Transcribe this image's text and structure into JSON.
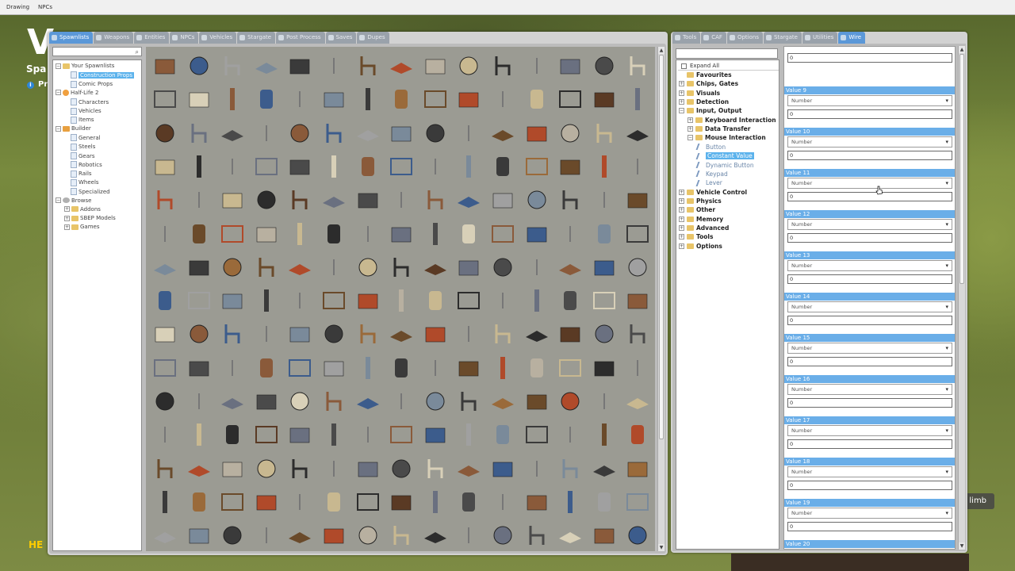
{
  "topmenu": {
    "items": [
      "Drawing",
      "NPCs"
    ]
  },
  "hud": {
    "title_fragment": "V",
    "spawn_fragment": "Spa",
    "pr_fragment": "Pr",
    "he_fragment": "HE",
    "limb_text": "s limb"
  },
  "spawn_panel": {
    "tabs": [
      "Spawnlists",
      "Weapons",
      "Entities",
      "NPCs",
      "Vehicles",
      "Stargate",
      "Post Process",
      "Saves",
      "Dupes"
    ],
    "search": {
      "value": "",
      "icon": "magnifier-icon"
    },
    "tree": [
      {
        "label": "Your Spawnlists",
        "level": 0,
        "icon": "folder"
      },
      {
        "label": "Construction Props",
        "level": 1,
        "icon": "page",
        "selected": true
      },
      {
        "label": "Comic Props",
        "level": 1,
        "icon": "page"
      },
      {
        "label": "Half-Life 2",
        "level": 0,
        "icon": "hl2"
      },
      {
        "label": "Characters",
        "level": 1,
        "icon": "page"
      },
      {
        "label": "Vehicles",
        "level": 1,
        "icon": "page"
      },
      {
        "label": "Items",
        "level": 1,
        "icon": "page"
      },
      {
        "label": "Builder",
        "level": 0,
        "icon": "builder"
      },
      {
        "label": "General",
        "level": 1,
        "icon": "page"
      },
      {
        "label": "Steels",
        "level": 1,
        "icon": "page"
      },
      {
        "label": "Gears",
        "level": 1,
        "icon": "page"
      },
      {
        "label": "Robotics",
        "level": 1,
        "icon": "page"
      },
      {
        "label": "Rails",
        "level": 1,
        "icon": "page"
      },
      {
        "label": "Wheels",
        "level": 1,
        "icon": "page"
      },
      {
        "label": "Specialized",
        "level": 1,
        "icon": "page"
      },
      {
        "label": "Browse",
        "level": 0,
        "icon": "browse"
      },
      {
        "label": "Addons",
        "level": 1,
        "icon": "folder"
      },
      {
        "label": "SBEP Models",
        "level": 1,
        "icon": "folder"
      },
      {
        "label": "Games",
        "level": 1,
        "icon": "folder"
      }
    ]
  },
  "tool_panel": {
    "tabs": [
      "Tools",
      "CAF",
      "Options",
      "Stargate",
      "Utilities",
      "Wire"
    ],
    "active_tab": "Wire",
    "search": {
      "value": ""
    },
    "expand_all": "Expand All",
    "tree": [
      {
        "label": "Favourites",
        "type": "folder"
      },
      {
        "label": "Chips, Gates",
        "type": "folder"
      },
      {
        "label": "Visuals",
        "type": "folder"
      },
      {
        "label": "Detection",
        "type": "folder"
      },
      {
        "label": "Input, Output",
        "type": "folder"
      },
      {
        "label": "Keyboard Interaction",
        "type": "folder"
      },
      {
        "label": "Data Transfer",
        "type": "folder"
      },
      {
        "label": "Mouse Interaction",
        "type": "folder"
      },
      {
        "label": "Button",
        "type": "leaf"
      },
      {
        "label": "Constant Value",
        "type": "leaf",
        "selected": true
      },
      {
        "label": "Dynamic Button",
        "type": "leaf"
      },
      {
        "label": "Keypad",
        "type": "leaf"
      },
      {
        "label": "Lever",
        "type": "leaf"
      },
      {
        "label": "Vehicle Control",
        "type": "folder"
      },
      {
        "label": "Physics",
        "type": "folder"
      },
      {
        "label": "Other",
        "type": "folder"
      },
      {
        "label": "Memory",
        "type": "folder"
      },
      {
        "label": "Advanced",
        "type": "folder"
      },
      {
        "label": "Tools",
        "type": "folder"
      },
      {
        "label": "Options",
        "type": "folder"
      }
    ],
    "values": [
      {
        "header": "",
        "type": "Number",
        "value": "0"
      },
      {
        "header": "Value 9",
        "type": "Number",
        "value": "0"
      },
      {
        "header": "Value 10",
        "type": "Number",
        "value": "0"
      },
      {
        "header": "Value 11",
        "type": "Number",
        "value": "0"
      },
      {
        "header": "Value 12",
        "type": "Number",
        "value": "0"
      },
      {
        "header": "Value 13",
        "type": "Number",
        "value": "0"
      },
      {
        "header": "Value 14",
        "type": "Number",
        "value": "0"
      },
      {
        "header": "Value 15",
        "type": "Number",
        "value": "0"
      },
      {
        "header": "Value 16",
        "type": "Number",
        "value": "0"
      },
      {
        "header": "Value 17",
        "type": "Number",
        "value": "0"
      },
      {
        "header": "Value 18",
        "type": "Number",
        "value": "0"
      },
      {
        "header": "Value 19",
        "type": "Number",
        "value": "0"
      },
      {
        "header": "Value 20",
        "type": "Number",
        "value": ""
      }
    ]
  },
  "colors": {
    "accent": "#5b98d8",
    "selection": "#5bb2ec",
    "value_header": "#6aaee8"
  }
}
